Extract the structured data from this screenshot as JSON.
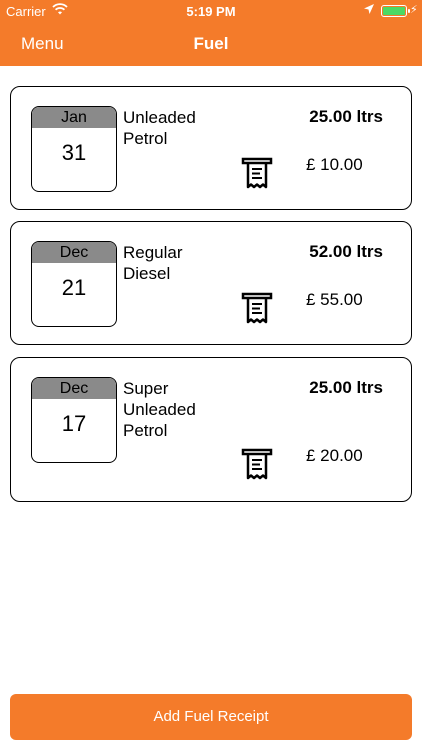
{
  "status_bar": {
    "carrier": "Carrier",
    "time": "5:19 PM"
  },
  "nav": {
    "menu_label": "Menu",
    "title": "Fuel"
  },
  "entries": [
    {
      "month": "Jan",
      "day": "31",
      "fuel_type": "Unleaded Petrol",
      "quantity": "25.00 ltrs",
      "price": "£ 10.00",
      "receipt_icon": "receipt-icon"
    },
    {
      "month": "Dec",
      "day": "21",
      "fuel_type": "Regular Diesel",
      "quantity": "52.00 ltrs",
      "price": "£ 55.00",
      "receipt_icon": "receipt-icon"
    },
    {
      "month": "Dec",
      "day": "17",
      "fuel_type": "Super Unleaded Petrol",
      "quantity": "25.00 ltrs",
      "price": "£ 20.00",
      "receipt_icon": "receipt-icon"
    }
  ],
  "add_button_label": "Add Fuel Receipt",
  "colors": {
    "accent": "#f47b2a",
    "calendar_header": "#8a8a8a",
    "battery": "#4cd964"
  }
}
